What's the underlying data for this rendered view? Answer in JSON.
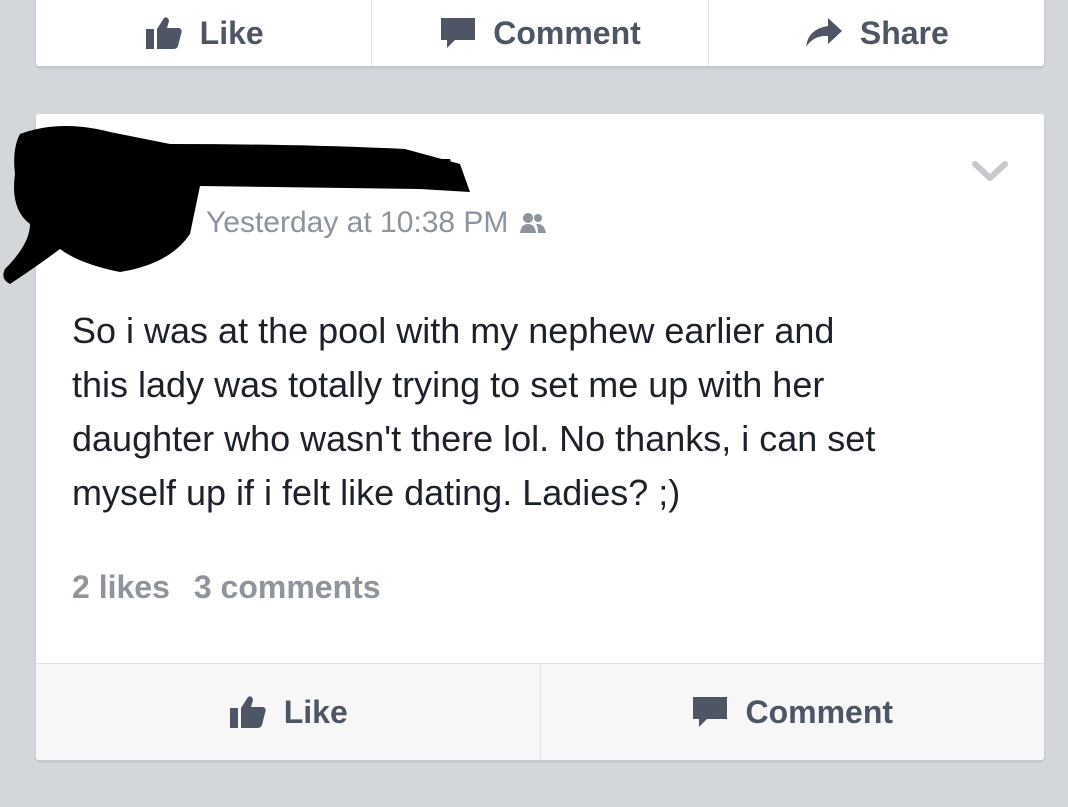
{
  "top_actions": {
    "like": "Like",
    "comment": "Comment",
    "share": "Share"
  },
  "post": {
    "timestamp": "Yesterday at 10:38 PM",
    "message": "So i was at the pool with my nephew earlier and\nthis lady was totally trying to set me up with her\ndaughter who wasn't there lol. No thanks, i can set\nmyself up if i felt like dating. Ladies? ;)",
    "likes": "2 likes",
    "comments": "3 comments",
    "actions": {
      "like": "Like",
      "comment": "Comment"
    }
  },
  "colors": {
    "background": "#d3d6db",
    "card": "#ffffff",
    "action_text": "#4e5665",
    "meta_text": "#8d949e",
    "body_text": "#1d2129"
  },
  "icons": [
    "thumbs-up-icon",
    "comment-bubble-icon",
    "share-arrow-icon",
    "chevron-down-icon",
    "friends-audience-icon"
  ]
}
